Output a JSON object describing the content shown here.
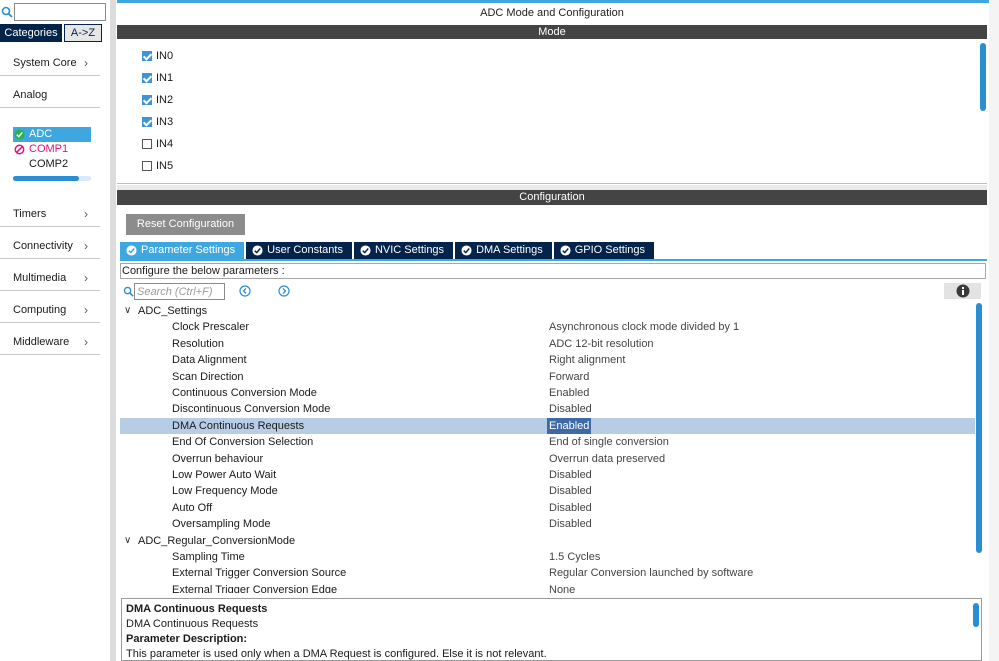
{
  "sidebar": {
    "search": {
      "value": "",
      "placeholder": ""
    },
    "tabs": [
      "Categories",
      "A->Z"
    ],
    "categories": [
      {
        "label": "System Core",
        "expandable": true
      },
      {
        "label": "Analog",
        "expandable": false
      },
      {
        "label": "Timers",
        "expandable": true
      },
      {
        "label": "Connectivity",
        "expandable": true
      },
      {
        "label": "Multimedia",
        "expandable": true
      },
      {
        "label": "Computing",
        "expandable": true
      },
      {
        "label": "Middleware",
        "expandable": true
      }
    ],
    "analog_items": [
      {
        "label": "ADC",
        "status": "ok",
        "selected": true
      },
      {
        "label": "COMP1",
        "status": "error",
        "selected": false
      },
      {
        "label": "COMP2",
        "status": "none",
        "selected": false
      }
    ]
  },
  "main": {
    "title": "ADC Mode and Configuration",
    "mode": {
      "header": "Mode",
      "inputs": [
        {
          "label": "IN0",
          "checked": true
        },
        {
          "label": "IN1",
          "checked": true
        },
        {
          "label": "IN2",
          "checked": true
        },
        {
          "label": "IN3",
          "checked": true
        },
        {
          "label": "IN4",
          "checked": false
        },
        {
          "label": "IN5",
          "checked": false
        }
      ]
    },
    "configuration": {
      "header": "Configuration",
      "reset_label": "Reset Configuration",
      "tabs": [
        {
          "label": "Parameter Settings",
          "active": true
        },
        {
          "label": "User Constants",
          "active": false
        },
        {
          "label": "NVIC Settings",
          "active": false
        },
        {
          "label": "DMA Settings",
          "active": false
        },
        {
          "label": "GPIO Settings",
          "active": false
        }
      ],
      "hint": "Configure the below parameters :",
      "search_placeholder": "Search (Ctrl+F)",
      "groups": [
        {
          "name": "ADC_Settings",
          "params": [
            {
              "name": "Clock Prescaler",
              "value": "Asynchronous clock mode divided by 1"
            },
            {
              "name": "Resolution",
              "value": "ADC 12-bit resolution"
            },
            {
              "name": "Data Alignment",
              "value": "Right alignment"
            },
            {
              "name": "Scan Direction",
              "value": "Forward"
            },
            {
              "name": "Continuous Conversion Mode",
              "value": "Enabled"
            },
            {
              "name": "Discontinuous Conversion Mode",
              "value": "Disabled"
            },
            {
              "name": "DMA Continuous Requests",
              "value": "Enabled",
              "selected": true
            },
            {
              "name": "End Of Conversion Selection",
              "value": "End of single conversion"
            },
            {
              "name": "Overrun behaviour",
              "value": "Overrun data preserved"
            },
            {
              "name": "Low Power Auto Wait",
              "value": "Disabled"
            },
            {
              "name": "Low Frequency Mode",
              "value": "Disabled"
            },
            {
              "name": "Auto Off",
              "value": "Disabled"
            },
            {
              "name": "Oversampling Mode",
              "value": "Disabled"
            }
          ]
        },
        {
          "name": "ADC_Regular_ConversionMode",
          "params": [
            {
              "name": "Sampling Time",
              "value": "1.5 Cycles"
            },
            {
              "name": "External Trigger Conversion Source",
              "value": "Regular Conversion launched by software"
            },
            {
              "name": "External Trigger Conversion Edge",
              "value": "None"
            }
          ]
        }
      ],
      "description": {
        "title": "DMA Continuous Requests",
        "subtitle": "DMA Continuous Requests",
        "section": "Parameter Description:",
        "text": "This parameter is used only when a DMA Request is configured. Else it is not relevant."
      }
    }
  },
  "colors": {
    "accent": "#3fa7e0",
    "dark_navy": "#03234b",
    "section_bar": "#444444",
    "selected_row": "#b7cde6",
    "error": "#e0137e",
    "ok": "#2bb24c"
  }
}
